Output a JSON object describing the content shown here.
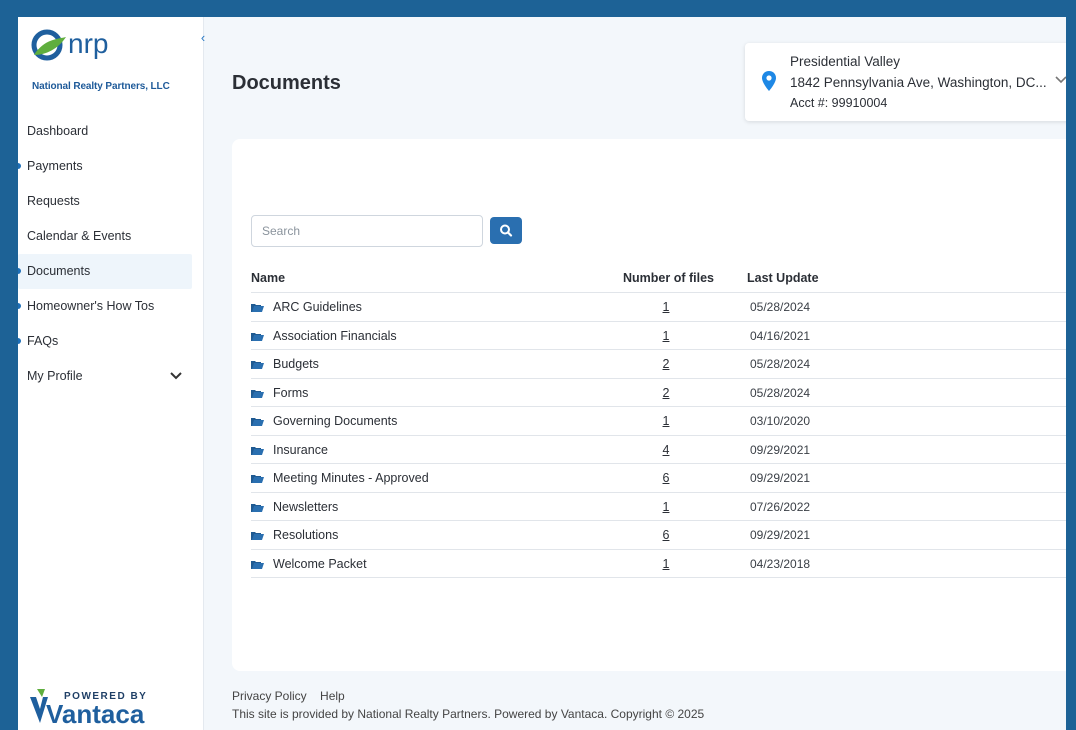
{
  "brand": {
    "logo_text": "nrp",
    "tagline": "National Realty Partners, LLC",
    "powered_by": "POWERED BY",
    "vendor": "Vantaca",
    "primary_color": "#1d6296",
    "accent_color": "#2a6fb0"
  },
  "sidebar": {
    "collapse_icon": "chevron-left-icon",
    "items": [
      {
        "label": "Dashboard",
        "dot": false
      },
      {
        "label": "Payments",
        "dot": true
      },
      {
        "label": "Requests",
        "dot": false
      },
      {
        "label": "Calendar & Events",
        "dot": false
      },
      {
        "label": "Documents",
        "dot": true,
        "active": true
      },
      {
        "label": "Homeowner's How Tos",
        "dot": true
      },
      {
        "label": "FAQs",
        "dot": true
      },
      {
        "label": "My Profile",
        "dot": false,
        "expandable": true
      }
    ]
  },
  "header": {
    "title": "Documents"
  },
  "property": {
    "name": "Presidential Valley",
    "address": "1842 Pennsylvania Ave, Washington, DC...",
    "account": "Acct #: 99910004",
    "icon": "map-pin-icon"
  },
  "search": {
    "placeholder": "Search",
    "value": "",
    "button_icon": "search-icon"
  },
  "table": {
    "columns": [
      "Name",
      "Number of files",
      "Last Update"
    ],
    "rows": [
      {
        "name": "ARC Guidelines",
        "count": "1",
        "date": "05/28/2024"
      },
      {
        "name": "Association Financials",
        "count": "1",
        "date": "04/16/2021"
      },
      {
        "name": "Budgets",
        "count": "2",
        "date": "05/28/2024"
      },
      {
        "name": "Forms",
        "count": "2",
        "date": "05/28/2024"
      },
      {
        "name": "Governing Documents",
        "count": "1",
        "date": "03/10/2020"
      },
      {
        "name": "Insurance",
        "count": "4",
        "date": "09/29/2021"
      },
      {
        "name": "Meeting Minutes - Approved",
        "count": "6",
        "date": "09/29/2021"
      },
      {
        "name": "Newsletters",
        "count": "1",
        "date": "07/26/2022"
      },
      {
        "name": "Resolutions",
        "count": "6",
        "date": "09/29/2021"
      },
      {
        "name": "Welcome Packet",
        "count": "1",
        "date": "04/23/2018"
      }
    ]
  },
  "footer": {
    "privacy": "Privacy Policy",
    "help": "Help",
    "copyright": "This site is provided by National Realty Partners. Powered by Vantaca. Copyright © 2025"
  }
}
